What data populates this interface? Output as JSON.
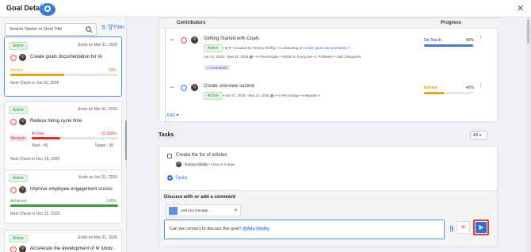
{
  "header": {
    "title": "Goal Details",
    "close_icon": "close-icon"
  },
  "left_pane": {
    "search_placeholder": "Search Owner or Goal Title",
    "filter_label": "Filter",
    "cards": [
      {
        "status": "Active",
        "ends": "Ends on Mar 31, 2026",
        "name": "Create goals documentation for IA",
        "stat_label": "Behind",
        "stat_value": "50%",
        "progress": 0.5,
        "next_check": "Next Check in Jan 01, 2026"
      },
      {
        "status": "Active",
        "ends": "Ends on Mar 31, 2026",
        "name": "Reduce hiring cycle time",
        "stat_label": "At Risk",
        "stat_value": "33.333%",
        "progress": 0.33,
        "priority": "Medium",
        "start": "Start : 45",
        "target": "Target : 30",
        "next_check": "Next Check in Dec 15, 2025"
      },
      {
        "status": "Active",
        "ends": "Ends on Jan 31, 2026",
        "name": "Improve employee engagement scores",
        "stat_label": "Achieved",
        "stat_value": "100%",
        "progress": 1.0,
        "next_check": "Next Check in Dec 15, 2025"
      },
      {
        "status": "Active",
        "ends": "Ends on Mar 31, 2026",
        "name": "Accelerate the development of hr know..."
      }
    ]
  },
  "contributors": {
    "col_contributors": "Contributors",
    "col_progress": "Progress",
    "items": [
      {
        "title": "Getting Started with Goals",
        "status": "Active",
        "created_by": "Created by Tommy Shelby",
        "contributing_to_label": "Contributing to",
        "contributing_to": "Create goals documentation f...",
        "dates": "Apr 01, 2025 - Mar 31, 2026",
        "measure": "% Percentage",
        "visibility": "Visible to Everyone",
        "followers": "1 Followers",
        "categories": "Add Categories",
        "chip": "1 Contributor",
        "progress_label": "On Track",
        "progress_value": "40%",
        "progress": 0.4
      },
      {
        "title": "Create overview section",
        "status": "Active",
        "dates": "Apr 01, 2025 - Mar 31, 2026",
        "measure": "% Percentage",
        "integrate": "Integrate",
        "progress_label": "Behind",
        "progress_value": "40%",
        "progress": 0.4
      }
    ],
    "add_label": "Add"
  },
  "tasks": {
    "title": "Tasks",
    "filter": "All",
    "items": [
      {
        "title": "Create the list of articles",
        "assignee": "Tommy Shelby",
        "due": "Due in 6 days"
      }
    ],
    "add_label": "Tasks"
  },
  "discussion": {
    "title": "Discuss with or add a comment",
    "attachment": "Add and manage ...",
    "message": "Can we connect to discuss this goal?",
    "mention": "@Ada Shelby"
  },
  "colors": {
    "accent": "#2b6fd6",
    "behind": "#e3a51b",
    "at_risk": "#d9342b",
    "achieved": "#3a9b3a",
    "on_track": "#4a7bd0"
  }
}
